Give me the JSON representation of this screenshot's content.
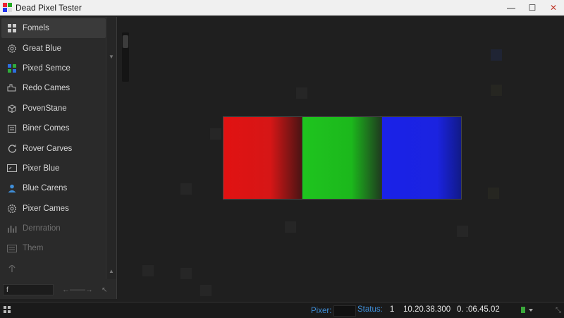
{
  "window": {
    "title": "Dead Pixel Tester",
    "minimize_glyph": "—",
    "maximize_glyph": "☐",
    "close_glyph": "✕"
  },
  "sidebar": {
    "items": [
      {
        "label": "Fomels",
        "icon": "grid-icon"
      },
      {
        "label": "Great Blue",
        "icon": "gear-icon"
      },
      {
        "label": "Pixed Semce",
        "icon": "color-squares-icon"
      },
      {
        "label": "Redo Cames",
        "icon": "hand-icon"
      },
      {
        "label": "PovenStane",
        "icon": "cube-icon"
      },
      {
        "label": "Biner Comes",
        "icon": "panel-icon"
      },
      {
        "label": "Rover Carves",
        "icon": "refresh-icon"
      },
      {
        "label": "Pixer Blue",
        "icon": "monitor-icon"
      },
      {
        "label": "Blue Carens",
        "icon": "user-icon"
      },
      {
        "label": "Pixer Cames",
        "icon": "settings-icon"
      },
      {
        "label": "Dernration",
        "icon": "bar-chart-icon"
      },
      {
        "label": "Them",
        "icon": "list-icon"
      }
    ],
    "footer": {
      "input_value": "f",
      "arrows_glyph": "←——→",
      "cursor_glyph": "↖"
    }
  },
  "status": {
    "pixel_label": "Pixer:",
    "status_label": "Status:",
    "status_value": "1",
    "coord_value": "10.20.38.300",
    "time_value": "0.  :06.45.02",
    "resize_glyph": "⤡"
  },
  "colors": {
    "red": "#e11212",
    "green": "#1fc41f",
    "blue": "#1a22e8",
    "accent_label": "#3f8ed8"
  }
}
